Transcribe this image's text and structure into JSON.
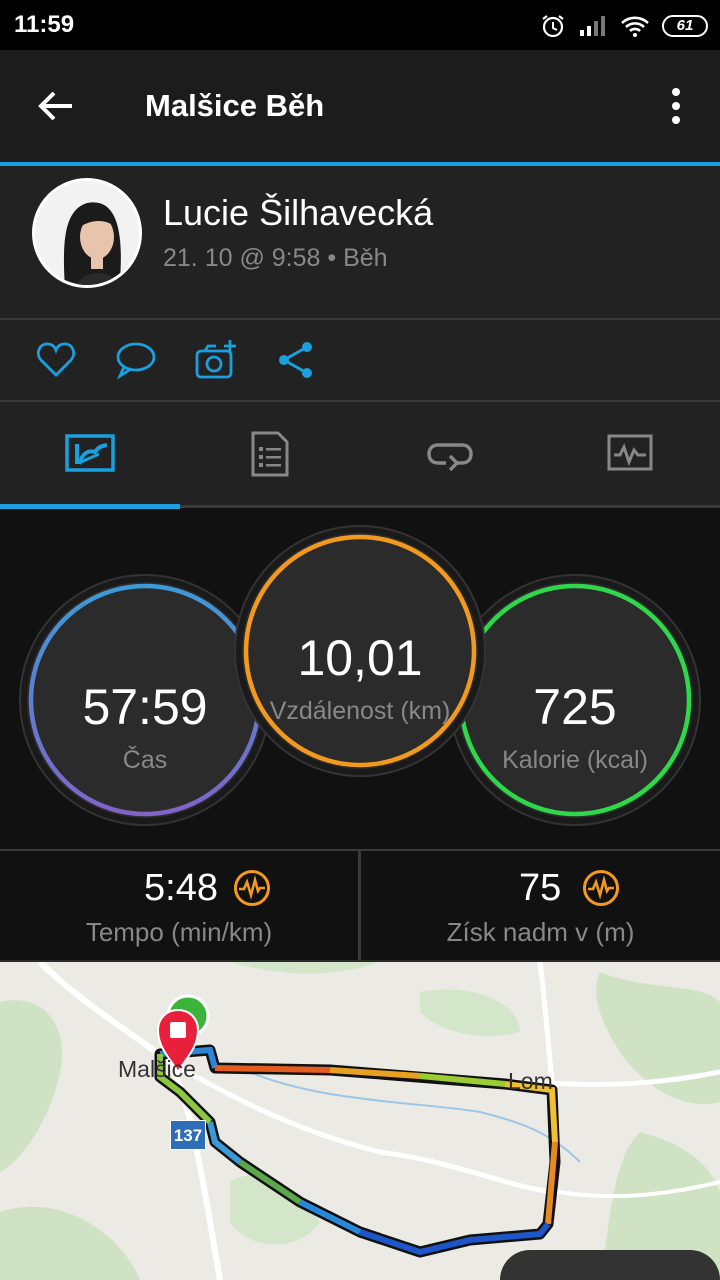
{
  "status_bar": {
    "time": "11:59",
    "battery": "61",
    "icons": [
      "alarm-icon",
      "signal-icon",
      "wifi-icon",
      "battery-icon"
    ]
  },
  "app_bar": {
    "title": "Malšice Běh",
    "back_icon": "arrow-back-icon",
    "menu_icon": "more-vert-icon",
    "accent_color": "#1a9fdf"
  },
  "profile": {
    "name": "Lucie Šilhavecká",
    "meta": "21. 10 @ 9:58 • Běh"
  },
  "actions": [
    "like-icon",
    "comment-icon",
    "add-photo-icon",
    "share-icon"
  ],
  "tabs": [
    {
      "icon": "overview-icon",
      "selected": true
    },
    {
      "icon": "details-icon",
      "selected": false
    },
    {
      "icon": "laps-icon",
      "selected": false
    },
    {
      "icon": "charts-icon",
      "selected": false
    }
  ],
  "stats": {
    "time": {
      "value": "57:59",
      "label": "Čas",
      "color": "#5a8fd8"
    },
    "distance": {
      "value": "10,01",
      "label": "Vzdálenost (km)",
      "color": "#f39a1e"
    },
    "calories": {
      "value": "725",
      "label": "Kalorie (kcal)",
      "color": "#2ed84a"
    }
  },
  "bottom_stats": {
    "pace": {
      "value": "5:48",
      "label": "Tempo (min/km)"
    },
    "elevation": {
      "value": "75",
      "label": "Získ nadm v (m)"
    }
  },
  "map": {
    "towns": [
      "Malšice",
      "Lom"
    ],
    "road_number": "137"
  }
}
